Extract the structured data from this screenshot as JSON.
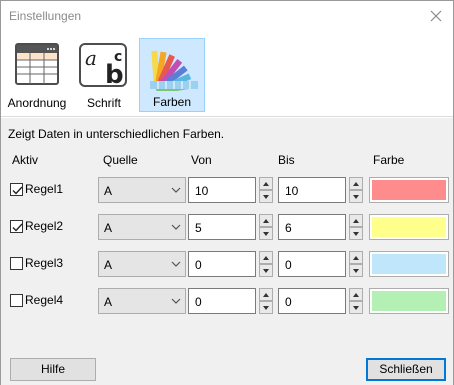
{
  "window": {
    "title": "Einstellungen"
  },
  "ribbon": {
    "buttons": [
      {
        "label": "Anordnung",
        "icon": "table-layout-icon",
        "active": false
      },
      {
        "label": "Schrift",
        "icon": "font-icon",
        "active": false
      },
      {
        "label": "Farben",
        "icon": "color-palette-icon",
        "active": true
      }
    ]
  },
  "description": "Zeigt Daten in unterschiedlichen Farben.",
  "headers": {
    "aktiv": "Aktiv",
    "quelle": "Quelle",
    "von": "Von",
    "bis": "Bis",
    "farbe": "Farbe"
  },
  "rules": [
    {
      "label": "Regel1",
      "checked": true,
      "quelle": "A",
      "von": "10",
      "bis": "10",
      "color": "#ff8c8c"
    },
    {
      "label": "Regel2",
      "checked": true,
      "quelle": "A",
      "von": "5",
      "bis": "6",
      "color": "#ffff8c"
    },
    {
      "label": "Regel3",
      "checked": false,
      "quelle": "A",
      "von": "0",
      "bis": "0",
      "color": "#bfe6fb"
    },
    {
      "label": "Regel4",
      "checked": false,
      "quelle": "A",
      "von": "0",
      "bis": "0",
      "color": "#b4f0b4"
    }
  ],
  "buttons": {
    "help": "Hilfe",
    "close": "Schließen"
  }
}
